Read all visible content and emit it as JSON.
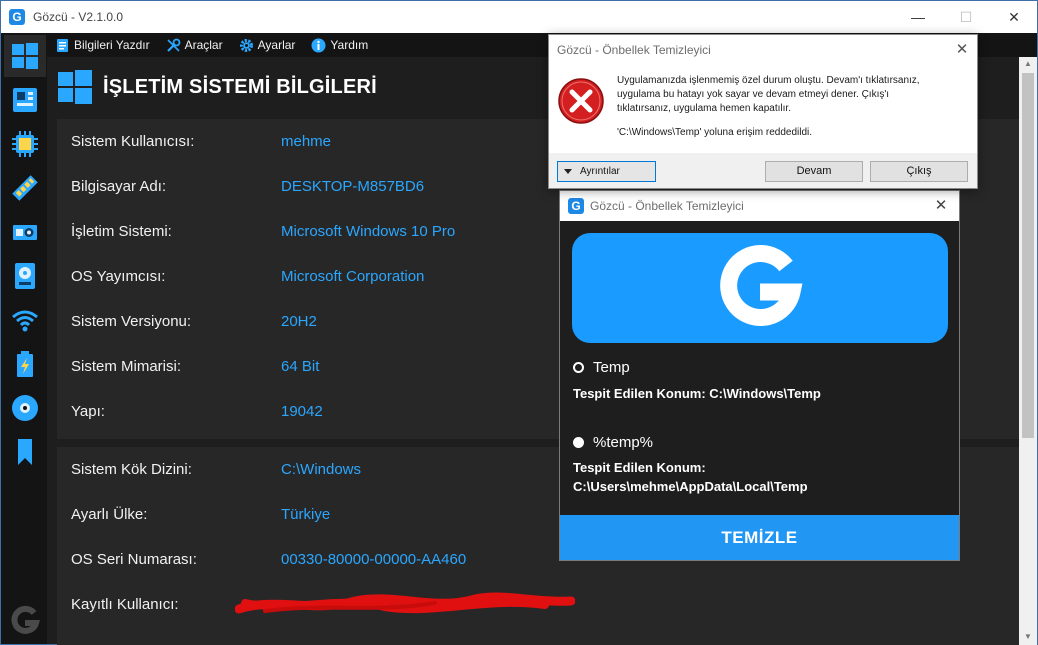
{
  "main_window": {
    "title": "Gözcü - V2.1.0.0",
    "controls": {
      "minimize": "—",
      "maximize": "☐",
      "close": "✕"
    }
  },
  "sidebar_icons": [
    "windows-icon",
    "motherboard-icon",
    "cpu-icon",
    "ram-icon",
    "gpu-icon",
    "disk-icon",
    "wifi-icon",
    "battery-icon",
    "optical-disc-icon",
    "bookmark-icon"
  ],
  "menu": {
    "print_info": "Bilgileri Yazdır",
    "tools": "Araçlar",
    "settings": "Ayarlar",
    "help": "Yardım"
  },
  "page": {
    "title": "İŞLETİM SİSTEMİ BİLGİLERİ"
  },
  "info_panel_1": [
    {
      "label": "Sistem Kullanıcısı:",
      "value": "mehme"
    },
    {
      "label": "Bilgisayar Adı:",
      "value": "DESKTOP-M857BD6"
    },
    {
      "label": "İşletim Sistemi:",
      "value": "Microsoft Windows 10 Pro"
    },
    {
      "label": "OS Yayımcısı:",
      "value": "Microsoft Corporation"
    },
    {
      "label": "Sistem Versiyonu:",
      "value": "20H2"
    },
    {
      "label": "Sistem Mimarisi:",
      "value": "64 Bit"
    },
    {
      "label": "Yapı:",
      "value": "19042"
    }
  ],
  "info_panel_2": [
    {
      "label": "Sistem Kök Dizini:",
      "value": "C:\\Windows"
    },
    {
      "label": "Ayarlı Ülke:",
      "value": "Türkiye"
    },
    {
      "label": "OS Seri Numarası:",
      "value": "00330-80000-00000-AA460"
    },
    {
      "label": "Kayıtlı Kullanıcı:",
      "value": ""
    }
  ],
  "cleaner_window": {
    "title": "Gözcü - Önbellek Temizleyici",
    "close": "✕",
    "option_1": {
      "label": "Temp",
      "location_label": "Tespit Edilen Konum:",
      "location_value": "C:\\Windows\\Temp"
    },
    "option_2": {
      "label": "%temp%",
      "location_label": "Tespit Edilen Konum:",
      "location_value": "C:\\Users\\mehme\\AppData\\Local\\Temp"
    },
    "clean_button": "TEMİZLE"
  },
  "error_dialog": {
    "title": "Gözcü - Önbellek Temizleyici",
    "close": "✕",
    "message_line_1": "Uygulamanızda işlenmemiş özel durum oluştu. Devam'ı tıklatırsanız,",
    "message_line_2": "uygulama bu hatayı yok sayar ve devam etmeyi dener. Çıkış'ı",
    "message_line_3": "tıklatırsanız, uygulama hemen kapatılır.",
    "message_line_4": "'C:\\Windows\\Temp' yoluna erişim reddedildi.",
    "details_button": "Ayrıntılar",
    "continue_button": "Devam",
    "exit_button": "Çıkış"
  },
  "colors": {
    "accent": "#2aa7ff",
    "banner": "#1a9bff",
    "clean_button": "#2196f3",
    "panel_bg": "#272727",
    "window_bg": "#1e1e1e"
  }
}
